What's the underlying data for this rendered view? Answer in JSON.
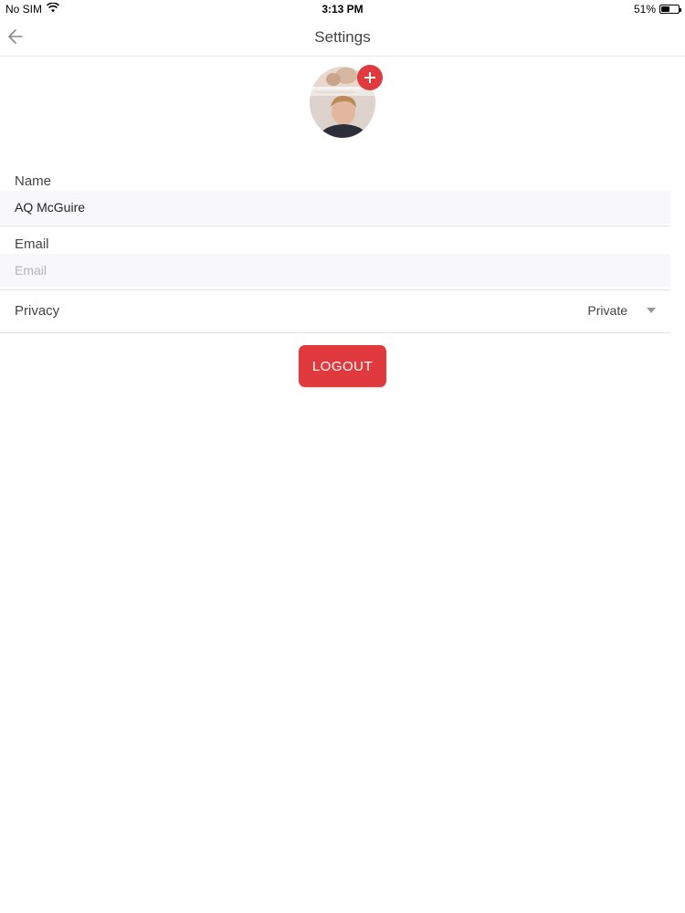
{
  "status_bar": {
    "carrier": "No SIM",
    "time": "3:13 PM",
    "battery": "51%",
    "battery_level": 0.51
  },
  "nav": {
    "title": "Settings",
    "back_icon": "arrow-left-icon"
  },
  "profile": {
    "add_photo_icon": "plus-icon",
    "accent_color": "#e03a3e"
  },
  "form": {
    "name_label": "Name",
    "name_value": "AQ McGuire",
    "email_label": "Email",
    "email_value": "",
    "email_placeholder": "Email",
    "privacy_label": "Privacy",
    "privacy_value": "Private"
  },
  "logout_label": "LOGOUT"
}
